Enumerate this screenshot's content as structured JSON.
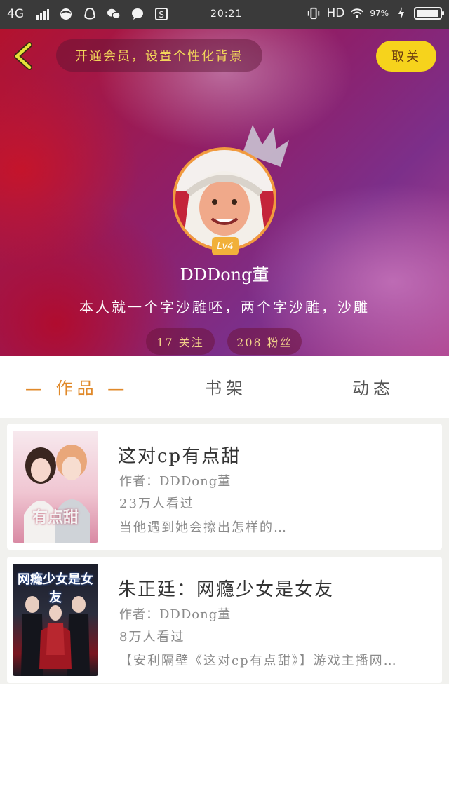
{
  "status_bar": {
    "network": "4G",
    "time": "20:21",
    "hd": "HD",
    "battery_percent": "97%",
    "battery_level": 0.97,
    "icons": [
      "browser-icon",
      "qq-icon",
      "wechat-icon",
      "message-icon",
      "s-app-icon",
      "vibrate-icon",
      "wifi-icon",
      "charging-icon"
    ]
  },
  "header": {
    "promo_text": "开通会员，设置个性化背景",
    "close_label": "取关",
    "level": "Lv4",
    "username": "DDDong董",
    "bio": "本人就一个字沙雕呸，两个字沙雕，沙雕",
    "following_label": "17 关注",
    "fans_label": "208 粉丝",
    "accent_color": "#f6d31c"
  },
  "tabs": {
    "works": "— 作品 —",
    "bookshelf": "书架",
    "moments": "动态",
    "active_color": "#e0892a"
  },
  "books": [
    {
      "title": "这对cp有点甜",
      "author": "作者：DDDong董",
      "views": "23万人看过",
      "desc": "当他遇到她会擦出怎样的…",
      "cover_text": "有点甜"
    },
    {
      "title": "朱正廷：网瘾少女是女友",
      "author": "作者：DDDong董",
      "views": "8万人看过",
      "desc": "【安利隔壁《这对cp有点甜》】游戏主播网…",
      "cover_text": "网瘾少女是女友"
    }
  ]
}
